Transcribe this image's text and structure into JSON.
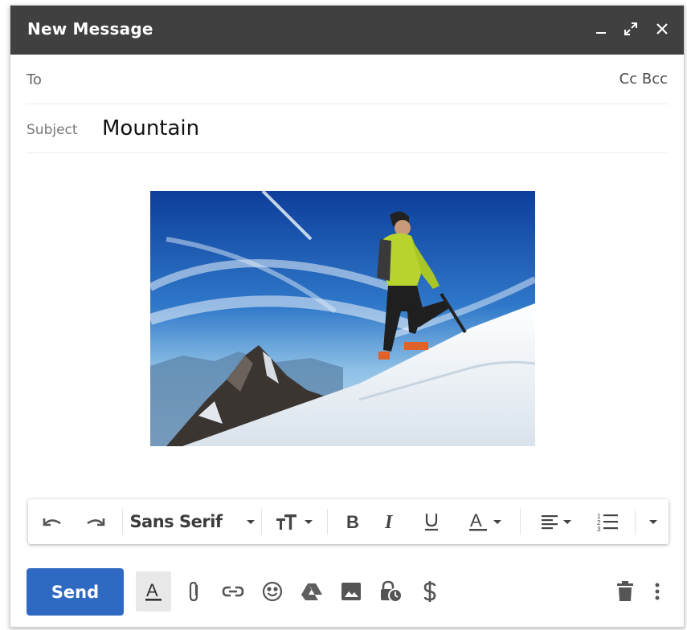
{
  "window": {
    "title": "New Message",
    "controls": [
      "minimize-icon",
      "expand-icon",
      "close-icon"
    ]
  },
  "recipients": {
    "to_label": "To",
    "to_value": "",
    "cc_bcc_label": "Cc Bcc"
  },
  "subject": {
    "label": "Subject",
    "value": "Mountain"
  },
  "body": {
    "image": "mountain-climber-photo"
  },
  "format_toolbar": {
    "font_name": "Sans Serif",
    "items": [
      "undo-icon",
      "redo-icon",
      "font-family-select",
      "text-size-icon",
      "bold-icon",
      "italic-icon",
      "underline-icon",
      "text-color-icon",
      "align-icon",
      "numbered-list-icon",
      "more-formatting-icon"
    ]
  },
  "bottom_toolbar": {
    "send_label": "Send",
    "items": [
      "formatting-options-icon",
      "attach-files-icon",
      "insert-link-icon",
      "insert-emoji-icon",
      "google-drive-icon",
      "insert-photo-icon",
      "confidential-mode-icon",
      "send-money-icon",
      "discard-draft-icon",
      "more-options-icon"
    ]
  },
  "colors": {
    "titlebar": "#404040",
    "send_button": "#2f6ac2",
    "icon": "#555555"
  }
}
